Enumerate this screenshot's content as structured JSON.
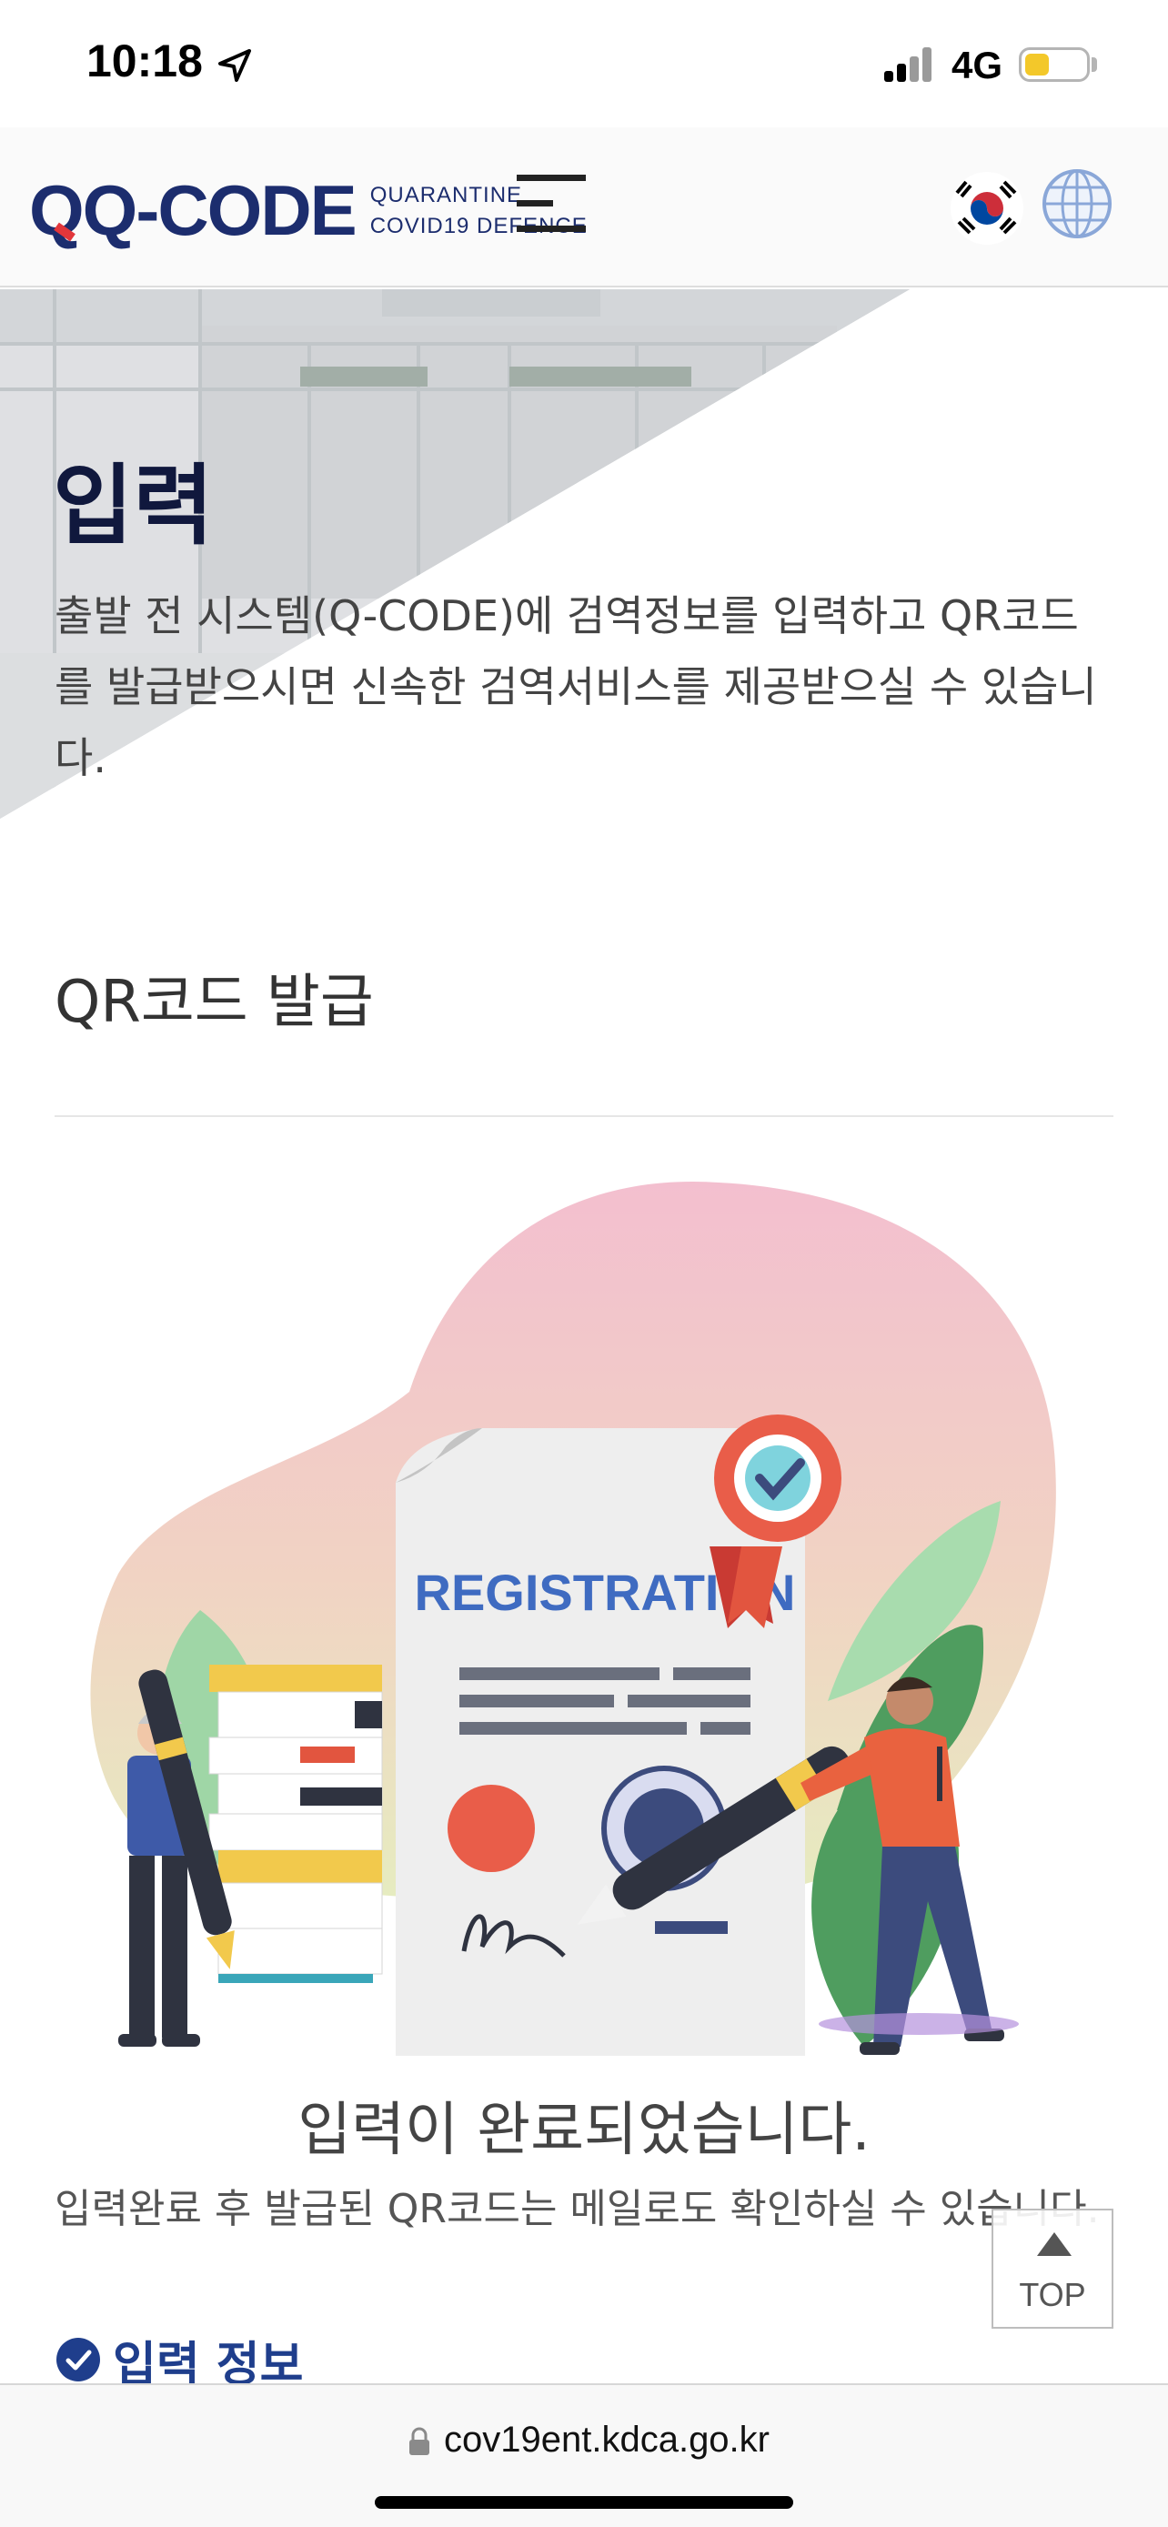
{
  "status_bar": {
    "time": "10:18",
    "network": "4G",
    "icons": [
      "location-arrow-icon",
      "signal-icon",
      "battery-icon"
    ],
    "battery_color": "#f3c82a"
  },
  "header": {
    "logo": {
      "brand": "CODE",
      "brand_prefix": "Q-",
      "sub_line1": "QUARANTINE",
      "sub_line2": "COVID19 DEFENCE"
    },
    "icons": [
      "menu-icon",
      "korea-flag-icon",
      "globe-icon"
    ],
    "brand_color": "#1c2d6e"
  },
  "hero": {
    "title": "입력",
    "description": "출발 전 시스템(Q-CODE)에 검역정보를 입력하고 QR코드를 발급받으시면 신속한 검역서비스를 제공받으실 수 있습니다."
  },
  "section": {
    "title": "QR코드 발급"
  },
  "illustration": {
    "document_label": "REGISTRATION"
  },
  "completion": {
    "title": "입력이 완료되었습니다.",
    "description": "입력완료 후 발급된 QR코드는 메일로도 확인하실 수 있습니다."
  },
  "info_link": {
    "label": "입력 정보",
    "icon": "check-circle-icon"
  },
  "top_button": {
    "label": "TOP",
    "icon": "arrow-up-icon"
  },
  "browser": {
    "url": "cov19ent.kdca.go.kr",
    "icon": "lock-icon"
  }
}
